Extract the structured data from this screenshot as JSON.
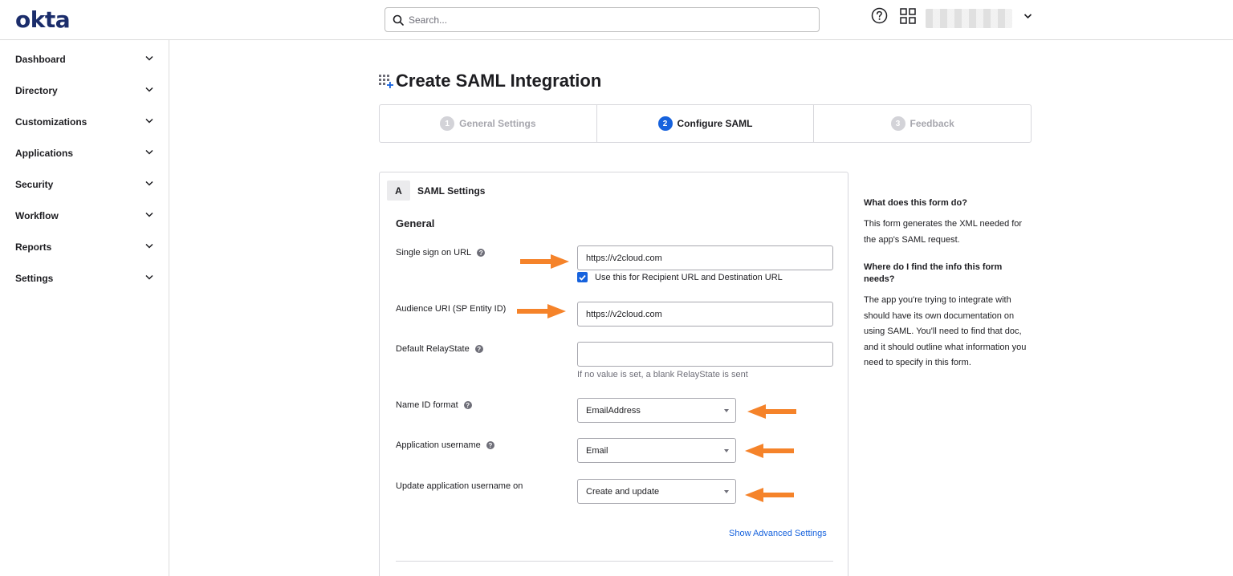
{
  "brand": {
    "logo": "okta"
  },
  "header": {
    "search_placeholder": "Search...",
    "icons": [
      "search-icon",
      "help-icon",
      "app-grid-icon",
      "chevron-down-icon"
    ]
  },
  "sidebar": {
    "items": [
      {
        "label": "Dashboard"
      },
      {
        "label": "Directory"
      },
      {
        "label": "Customizations"
      },
      {
        "label": "Applications"
      },
      {
        "label": "Security"
      },
      {
        "label": "Workflow"
      },
      {
        "label": "Reports"
      },
      {
        "label": "Settings"
      }
    ]
  },
  "page": {
    "title": "Create SAML Integration"
  },
  "steps": [
    {
      "num": "1",
      "label": "General Settings",
      "state": "inactive"
    },
    {
      "num": "2",
      "label": "Configure SAML",
      "state": "active"
    },
    {
      "num": "3",
      "label": "Feedback",
      "state": "inactive"
    }
  ],
  "section": {
    "badge": "A",
    "title": "SAML Settings",
    "group_title": "General",
    "fields": {
      "sso_url": {
        "label": "Single sign on URL",
        "value": "https://v2cloud.com"
      },
      "recipient_checkbox": {
        "label": "Use this for Recipient URL and Destination URL",
        "checked": true
      },
      "audience_uri": {
        "label": "Audience URI (SP Entity ID)",
        "value": "https://v2cloud.com"
      },
      "relay_state": {
        "label": "Default RelayState",
        "value": "",
        "hint": "If no value is set, a blank RelayState is sent"
      },
      "name_id_format": {
        "label": "Name ID format",
        "value": "EmailAddress"
      },
      "app_username": {
        "label": "Application username",
        "value": "Email"
      },
      "update_username_on": {
        "label": "Update application username on",
        "value": "Create and update"
      }
    },
    "advanced_link": "Show Advanced Settings"
  },
  "help_panel": {
    "q1": "What does this form do?",
    "a1": "This form generates the XML needed for the app's SAML request.",
    "q2": "Where do I find the info this form needs?",
    "a2": "The app you're trying to integrate with should have its own documentation on using SAML. You'll need to find that doc, and it should outline what information you need to specify in this form."
  },
  "colors": {
    "brand_navy": "#1b2d6b",
    "accent_blue": "#1662dd",
    "annotation_arrow": "#f5832a"
  }
}
